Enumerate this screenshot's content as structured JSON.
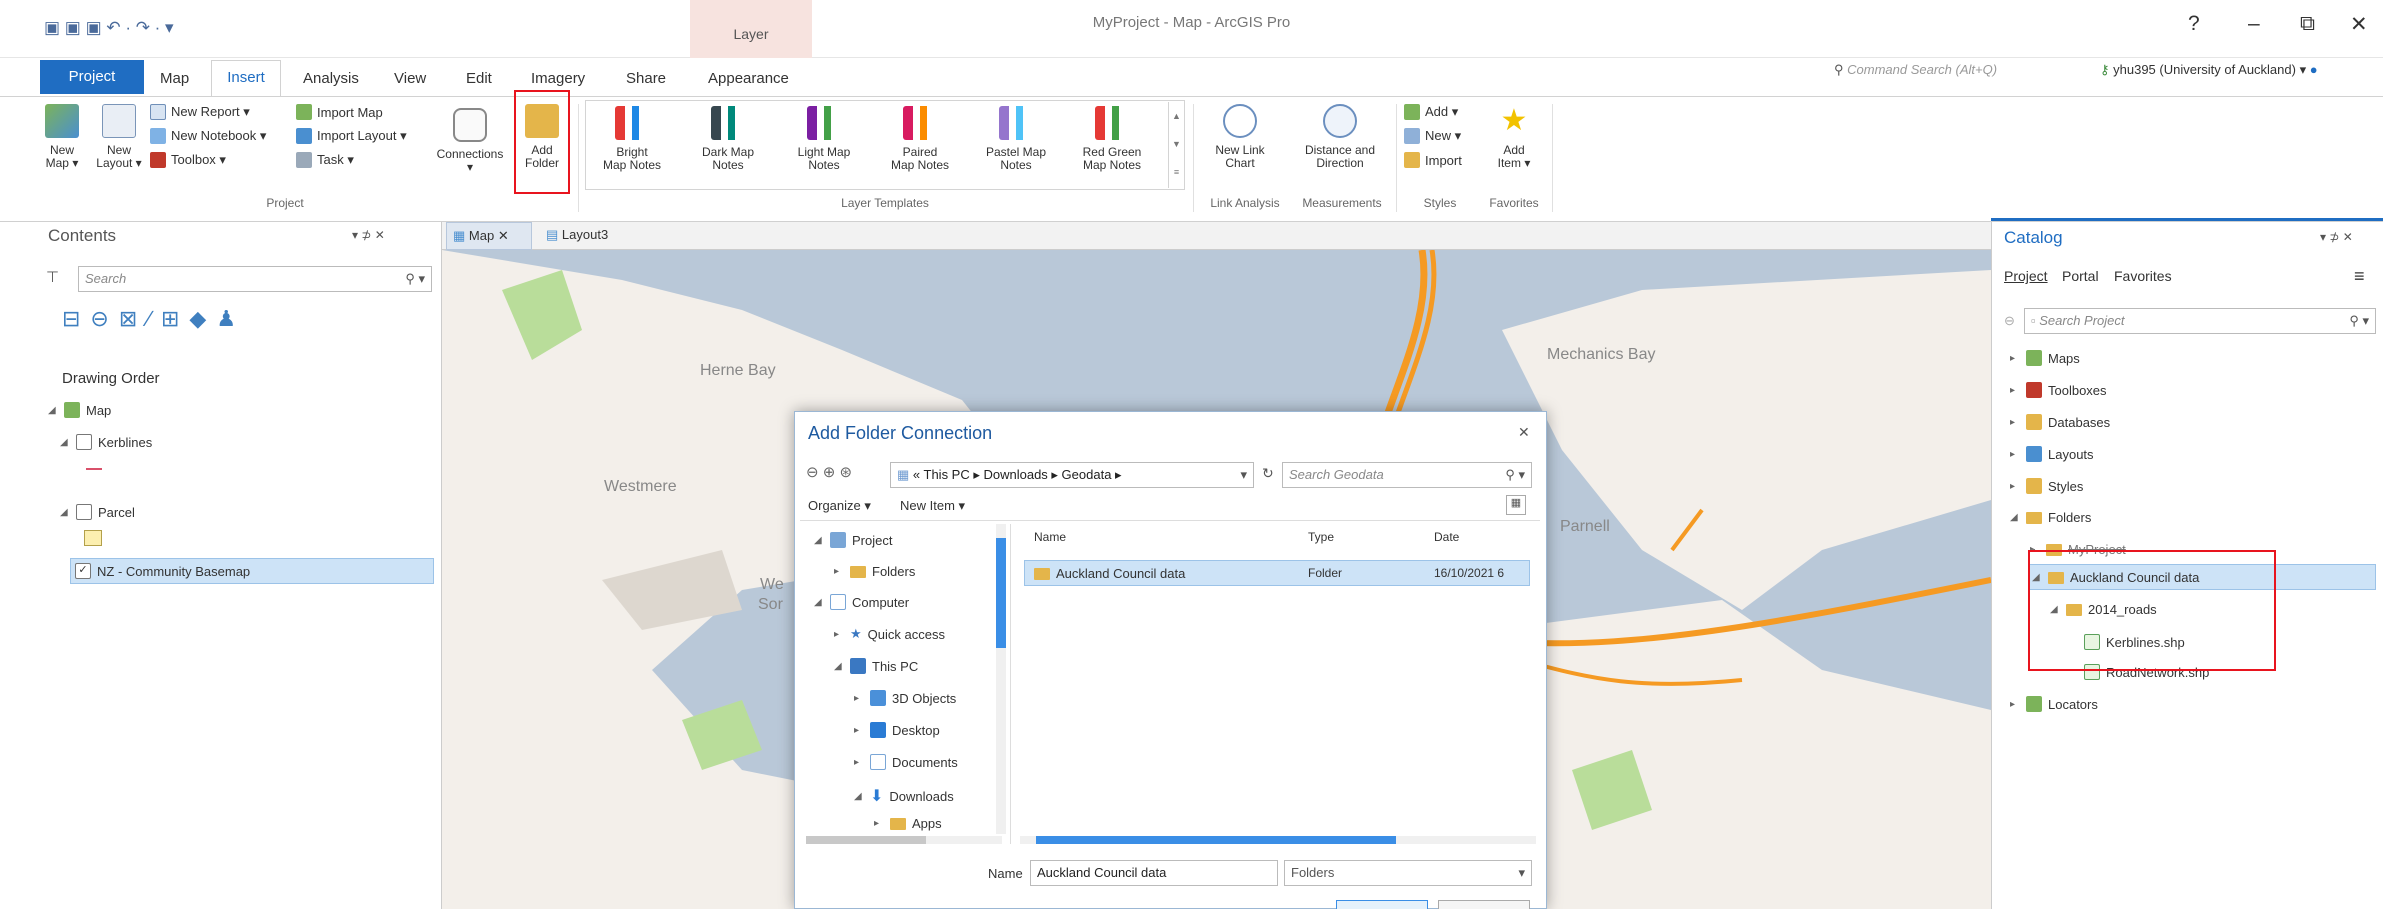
{
  "window": {
    "title": "MyProject - Map - ArcGIS Pro",
    "context_tab_group": "Layer",
    "help": "?",
    "minimize": "–",
    "restore": "⧉",
    "close": "✕"
  },
  "tabs": [
    "Project",
    "Map",
    "Insert",
    "Analysis",
    "View",
    "Edit",
    "Imagery",
    "Share",
    "Appearance"
  ],
  "command_search": {
    "placeholder": "Command Search (Alt+Q)"
  },
  "user": {
    "label": "yhu395 (University of Auckland) ▾"
  },
  "ribbon": {
    "project_group": {
      "label": "Project",
      "new_map": "New\nMap ▾",
      "new_layout": "New\nLayout ▾",
      "new_report": "New Report ▾",
      "new_notebook": "New Notebook ▾",
      "toolbox": "Toolbox ▾",
      "import_map": "Import Map",
      "import_layout": "Import Layout ▾",
      "task": "Task ▾",
      "connections": "Connections\n▾",
      "add_folder": "Add\nFolder"
    },
    "layer_templates": {
      "label": "Layer Templates",
      "items": [
        "Bright\nMap Notes",
        "Dark Map\nNotes",
        "Light Map\nNotes",
        "Paired\nMap Notes",
        "Pastel Map\nNotes",
        "Red Green\nMap Notes"
      ]
    },
    "link_analysis": {
      "label": "Link Analysis",
      "new_link_chart": "New Link\nChart"
    },
    "measurements": {
      "label": "Measurements",
      "distance": "Distance and\nDirection"
    },
    "styles": {
      "label": "Styles",
      "add": "Add ▾",
      "new": "New ▾",
      "import": "Import"
    },
    "favorites": {
      "label": "Favorites",
      "add_item": "Add\nItem ▾"
    }
  },
  "contents": {
    "title": "Contents",
    "pin": "▾ ⊅ ✕",
    "search_placeholder": "Search",
    "section": "Drawing Order",
    "items": [
      {
        "label": "Map"
      },
      {
        "label": "Kerblines"
      },
      {
        "label": "Parcel"
      },
      {
        "label": "NZ - Community Basemap"
      }
    ]
  },
  "map_tabs": [
    "Map",
    "Layout3"
  ],
  "map_labels": [
    "Herne Bay",
    "Westmere",
    "Mechanics Bay",
    "Parnell",
    "We",
    "Sor"
  ],
  "dialog": {
    "title": "Add Folder Connection",
    "close": "✕",
    "breadcrumb": "« This PC  ▸  Downloads  ▸  Geodata  ▸",
    "search_placeholder": "Search Geodata",
    "organize": "Organize ▾",
    "new_item": "New Item ▾",
    "nav": [
      {
        "label": "Project"
      },
      {
        "label": "Folders"
      },
      {
        "label": "Computer"
      },
      {
        "label": "Quick access"
      },
      {
        "label": "This PC"
      },
      {
        "label": "3D Objects"
      },
      {
        "label": "Desktop"
      },
      {
        "label": "Documents"
      },
      {
        "label": "Downloads"
      },
      {
        "label": "Apps"
      }
    ],
    "columns": [
      "Name",
      "Type",
      "Date"
    ],
    "rows": [
      {
        "name": "Auckland Council data",
        "type": "Folder",
        "date": "16/10/2021 6"
      }
    ],
    "name_label": "Name",
    "name_value": "Auckland Council data",
    "filter": "Folders"
  },
  "catalog": {
    "title": "Catalog",
    "pin": "▾ ⊅ ✕",
    "tabs": [
      "Project",
      "Portal",
      "Favorites"
    ],
    "menu": "≡",
    "search_placeholder": "Search Project",
    "items": [
      {
        "label": "Maps"
      },
      {
        "label": "Toolboxes"
      },
      {
        "label": "Databases"
      },
      {
        "label": "Layouts"
      },
      {
        "label": "Styles"
      },
      {
        "label": "Folders"
      },
      {
        "label": "MyProject"
      },
      {
        "label": "Auckland Council data"
      },
      {
        "label": "2014_roads"
      },
      {
        "label": "Kerblines.shp"
      },
      {
        "label": "RoadNetwork.shp"
      },
      {
        "label": "Locators"
      }
    ]
  }
}
